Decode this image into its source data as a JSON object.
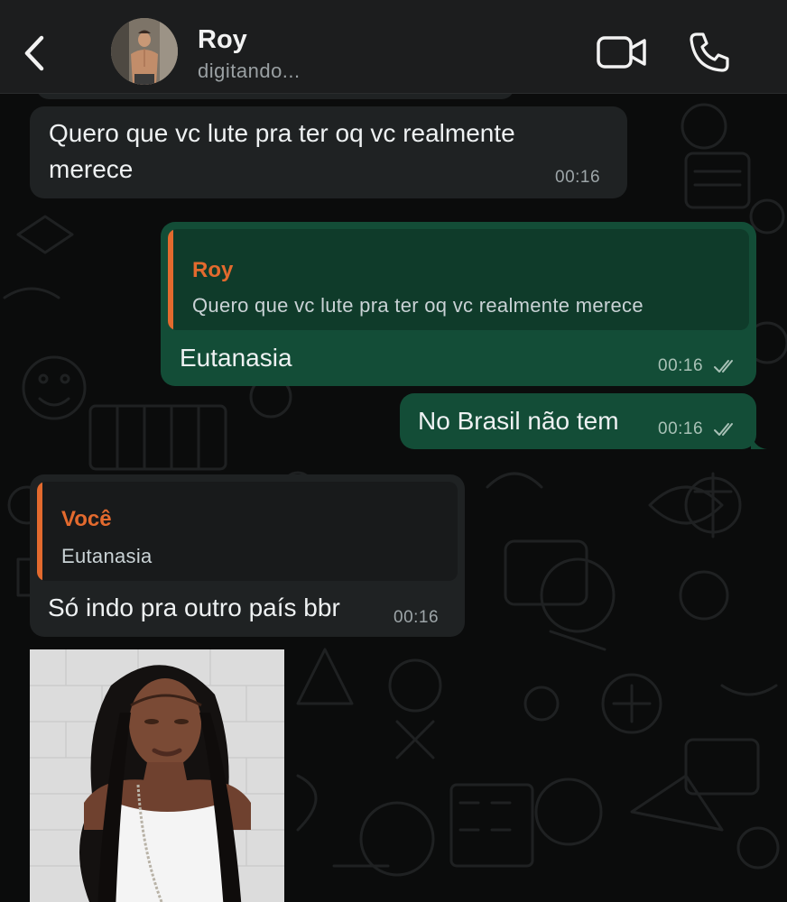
{
  "header": {
    "contact_name": "Roy",
    "status": "digitando...",
    "icons": [
      "back-icon",
      "avatar",
      "video-call-icon",
      "phone-icon"
    ]
  },
  "messages": [
    {
      "direction": "incoming",
      "text_line1": "Quero que vc lute pra ter oq vc realmente",
      "text_line2": "merece",
      "time": "00:16"
    },
    {
      "direction": "outgoing",
      "quote_name": "Roy",
      "quote_text": "Quero que vc lute pra ter oq vc realmente merece",
      "text": "Eutanasia",
      "time": "00:16",
      "status": "read"
    },
    {
      "direction": "outgoing",
      "text": "No Brasil não tem",
      "time": "00:16",
      "status": "read"
    },
    {
      "direction": "incoming",
      "quote_name": "Você",
      "quote_text": "Eutanasia",
      "text": "Só indo pra outro país bbr",
      "time": "00:16"
    },
    {
      "direction": "incoming",
      "type": "image"
    }
  ],
  "colors": {
    "incoming_bubble": "#1f2223",
    "outgoing_bubble": "#134d37",
    "quote_accent": "#e36a2e",
    "header_bg": "#1c1d1e"
  }
}
